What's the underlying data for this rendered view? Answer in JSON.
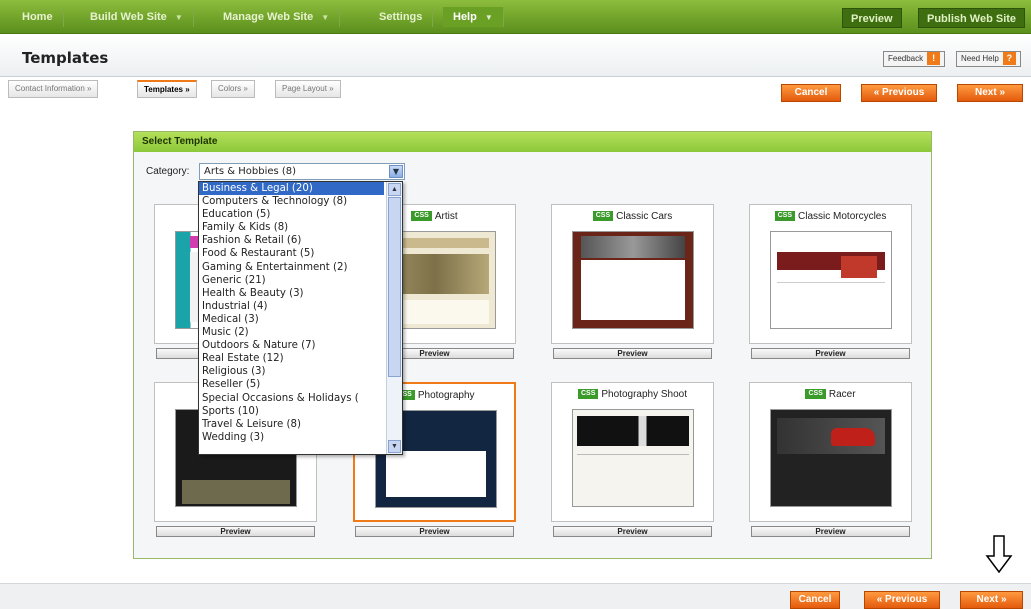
{
  "nav": {
    "items": [
      {
        "label": "Home",
        "arrow": false
      },
      {
        "label": "Build Web Site",
        "arrow": true
      },
      {
        "label": "Manage Web Site",
        "arrow": true
      },
      {
        "label": "Settings",
        "arrow": false
      },
      {
        "label": "Help",
        "arrow": true,
        "active": true
      }
    ],
    "preview": "Preview",
    "publish": "Publish Web Site"
  },
  "header": {
    "title": "Templates",
    "feedback": "Feedback",
    "feedback_badge": "!",
    "need_help": "Need Help",
    "need_help_badge": "?"
  },
  "steps": [
    {
      "label": "Contact Information »"
    },
    {
      "label": "Templates »",
      "current": true
    },
    {
      "label": "Colors »"
    },
    {
      "label": "Page Layout »"
    }
  ],
  "actions": {
    "cancel": "Cancel",
    "previous": "« Previous",
    "next": "Next »"
  },
  "panel": {
    "heading": "Select Template",
    "category_label": "Category:",
    "category_value": "Arts & Hobbies (8)",
    "css_badge": "CSS",
    "preview_label": "Preview"
  },
  "dropdown_options": [
    "Business & Legal (20)",
    "Computers & Technology (8)",
    "Education (5)",
    "Family & Kids (8)",
    "Fashion & Retail (6)",
    "Food & Restaurant (5)",
    "Gaming & Entertainment (2)",
    "Generic (21)",
    "Health & Beauty (3)",
    "Industrial (4)",
    "Medical (3)",
    "Music (2)",
    "Outdoors & Nature (7)",
    "Real Estate (12)",
    "Religious (3)",
    "Reseller (5)",
    "Special Occasions & Holidays (",
    "Sports (10)",
    "Travel & Leisure (8)",
    "Wedding (3)"
  ],
  "highlighted_option": "Business & Legal (20)",
  "templates": [
    {
      "name": "",
      "theme": "teal"
    },
    {
      "name": "Artist",
      "theme": "beige"
    },
    {
      "name": "Classic Cars",
      "theme": "maroon"
    },
    {
      "name": "Classic Motorcycles",
      "theme": "white-red"
    },
    {
      "name": "",
      "theme": "dark-olive"
    },
    {
      "name": "Photography",
      "theme": "navy",
      "selected": true
    },
    {
      "name": "Photography Shoot",
      "theme": "bw"
    },
    {
      "name": "Racer",
      "theme": "dark-car"
    }
  ],
  "colors": {
    "nav_green": "#6aa024",
    "panel_head": "#9bd047",
    "orange": "#f07a18",
    "highlight": "#3169c6"
  }
}
